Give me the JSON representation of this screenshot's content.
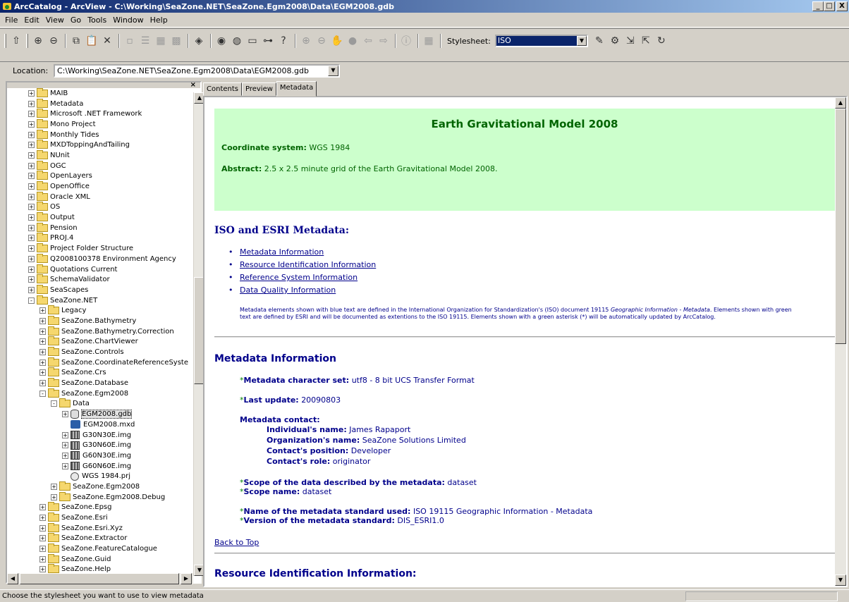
{
  "window": {
    "title": "ArcCatalog - ArcView - C:\\Working\\SeaZone.NET\\SeaZone.Egm2008\\Data\\EGM2008.gdb",
    "min": "_",
    "max": "□",
    "close": "X"
  },
  "menu": [
    "File",
    "Edit",
    "View",
    "Go",
    "Tools",
    "Window",
    "Help"
  ],
  "toolbar": {
    "stylesheet_label": "Stylesheet:",
    "stylesheet_value": "ISO"
  },
  "location": {
    "label": "Location:",
    "value": "C:\\Working\\SeaZone.NET\\SeaZone.Egm2008\\Data\\EGM2008.gdb"
  },
  "tree": [
    {
      "label": "MAIB",
      "indent": 1,
      "icon": "folder",
      "exp": "+"
    },
    {
      "label": "Metadata",
      "indent": 1,
      "icon": "folder",
      "exp": "+"
    },
    {
      "label": "Microsoft .NET Framework",
      "indent": 1,
      "icon": "folder",
      "exp": "+"
    },
    {
      "label": "Mono Project",
      "indent": 1,
      "icon": "folder",
      "exp": "+"
    },
    {
      "label": "Monthly Tides",
      "indent": 1,
      "icon": "folder",
      "exp": "+"
    },
    {
      "label": "MXDToppingAndTailing",
      "indent": 1,
      "icon": "folder",
      "exp": "+"
    },
    {
      "label": "NUnit",
      "indent": 1,
      "icon": "folder",
      "exp": "+"
    },
    {
      "label": "OGC",
      "indent": 1,
      "icon": "folder",
      "exp": "+"
    },
    {
      "label": "OpenLayers",
      "indent": 1,
      "icon": "folder",
      "exp": "+"
    },
    {
      "label": "OpenOffice",
      "indent": 1,
      "icon": "folder",
      "exp": "+"
    },
    {
      "label": "Oracle XML",
      "indent": 1,
      "icon": "folder",
      "exp": "+"
    },
    {
      "label": "OS",
      "indent": 1,
      "icon": "folder",
      "exp": "+"
    },
    {
      "label": "Output",
      "indent": 1,
      "icon": "folder",
      "exp": "+"
    },
    {
      "label": "Pension",
      "indent": 1,
      "icon": "folder",
      "exp": "+"
    },
    {
      "label": "PROJ.4",
      "indent": 1,
      "icon": "folder",
      "exp": "+"
    },
    {
      "label": "Project Folder Structure",
      "indent": 1,
      "icon": "folder",
      "exp": "+"
    },
    {
      "label": "Q2008100378 Environment Agency",
      "indent": 1,
      "icon": "folder",
      "exp": "+"
    },
    {
      "label": "Quotations Current",
      "indent": 1,
      "icon": "folder",
      "exp": "+"
    },
    {
      "label": "SchemaValidator",
      "indent": 1,
      "icon": "folder",
      "exp": "+"
    },
    {
      "label": "SeaScapes",
      "indent": 1,
      "icon": "folder",
      "exp": "+"
    },
    {
      "label": "SeaZone.NET",
      "indent": 1,
      "icon": "folder",
      "exp": "-"
    },
    {
      "label": "Legacy",
      "indent": 2,
      "icon": "folder",
      "exp": "+"
    },
    {
      "label": "SeaZone.Bathymetry",
      "indent": 2,
      "icon": "folder",
      "exp": "+"
    },
    {
      "label": "SeaZone.Bathymetry.Correction",
      "indent": 2,
      "icon": "folder",
      "exp": "+"
    },
    {
      "label": "SeaZone.ChartViewer",
      "indent": 2,
      "icon": "folder",
      "exp": "+"
    },
    {
      "label": "SeaZone.Controls",
      "indent": 2,
      "icon": "folder",
      "exp": "+"
    },
    {
      "label": "SeaZone.CoordinateReferenceSyste",
      "indent": 2,
      "icon": "folder",
      "exp": "+"
    },
    {
      "label": "SeaZone.Crs",
      "indent": 2,
      "icon": "folder",
      "exp": "+"
    },
    {
      "label": "SeaZone.Database",
      "indent": 2,
      "icon": "folder",
      "exp": "+"
    },
    {
      "label": "SeaZone.Egm2008",
      "indent": 2,
      "icon": "folder",
      "exp": "-"
    },
    {
      "label": "Data",
      "indent": 3,
      "icon": "folder",
      "exp": "-"
    },
    {
      "label": "EGM2008.gdb",
      "indent": 4,
      "icon": "db",
      "exp": "+",
      "selected": true
    },
    {
      "label": "EGM2008.mxd",
      "indent": 4,
      "icon": "mxd",
      "exp": ""
    },
    {
      "label": "G30N30E.img",
      "indent": 4,
      "icon": "img",
      "exp": "+"
    },
    {
      "label": "G30N60E.img",
      "indent": 4,
      "icon": "img",
      "exp": "+"
    },
    {
      "label": "G60N30E.img",
      "indent": 4,
      "icon": "img",
      "exp": "+"
    },
    {
      "label": "G60N60E.img",
      "indent": 4,
      "icon": "img",
      "exp": "+"
    },
    {
      "label": "WGS 1984.prj",
      "indent": 4,
      "icon": "prj",
      "exp": ""
    },
    {
      "label": "SeaZone.Egm2008",
      "indent": 3,
      "icon": "folder",
      "exp": "+"
    },
    {
      "label": "SeaZone.Egm2008.Debug",
      "indent": 3,
      "icon": "folder",
      "exp": "+"
    },
    {
      "label": "SeaZone.Epsg",
      "indent": 2,
      "icon": "folder",
      "exp": "+"
    },
    {
      "label": "SeaZone.Esri",
      "indent": 2,
      "icon": "folder",
      "exp": "+"
    },
    {
      "label": "SeaZone.Esri.Xyz",
      "indent": 2,
      "icon": "folder",
      "exp": "+"
    },
    {
      "label": "SeaZone.Extractor",
      "indent": 2,
      "icon": "folder",
      "exp": "+"
    },
    {
      "label": "SeaZone.FeatureCatalogue",
      "indent": 2,
      "icon": "folder",
      "exp": "+"
    },
    {
      "label": "SeaZone.Guid",
      "indent": 2,
      "icon": "folder",
      "exp": "+"
    },
    {
      "label": "SeaZone.Help",
      "indent": 2,
      "icon": "folder",
      "exp": "+"
    }
  ],
  "tabs": [
    "Contents",
    "Preview",
    "Metadata"
  ],
  "doc": {
    "title": "Earth Gravitational Model 2008",
    "coord_label": "Coordinate system:",
    "coord_value": "WGS 1984",
    "abstract_label": "Abstract:",
    "abstract_value": "2.5 x 2.5 minute grid of the Earth Gravitational Model 2008.",
    "iso_heading": "ISO and ESRI Metadata:",
    "links": [
      "Metadata Information",
      "Resource Identification Information",
      "Reference System Information",
      "Data Quality Information"
    ],
    "note_a": "Metadata elements shown with blue text are defined in the International Organization for Standardization's (ISO) document 19115 ",
    "note_italic": "Geographic Information - Metadata",
    "note_b": ". Elements shown with green text are defined by ESRI and will be documented as extentions to the ISO 19115. Elements shown with a green asterisk (*) will be automatically updated by ArcCatalog.",
    "meta_heading": "Metadata Information",
    "charset_label": "Metadata character set:",
    "charset_value": "utf8 - 8 bit UCS Transfer Format",
    "update_label": "Last update:",
    "update_value": "20090803",
    "contact_label": "Metadata contact:",
    "indiv_label": "Individual's name:",
    "indiv_value": "James Rapaport",
    "org_label": "Organization's name:",
    "org_value": "SeaZone Solutions Limited",
    "pos_label": "Contact's position:",
    "pos_value": "Developer",
    "role_label": "Contact's role:",
    "role_value": "originator",
    "scope_label": "Scope of the data described by the metadata:",
    "scope_value": "dataset",
    "scopename_label": "Scope name:",
    "scopename_value": "dataset",
    "std_label": "Name of the metadata standard used:",
    "std_value": "ISO 19115 Geographic Information - Metadata",
    "ver_label": "Version of the metadata standard:",
    "ver_value": "DIS_ESRI1.0",
    "back_to_top": "Back to Top",
    "resource_heading": "Resource Identification Information:"
  },
  "status": "Choose the stylesheet you want to use to view metadata",
  "colors": {
    "title_bar": "#0a246a",
    "green_box": "#ccffcc",
    "iso_blue": "#00008b",
    "esri_green": "#008000"
  }
}
